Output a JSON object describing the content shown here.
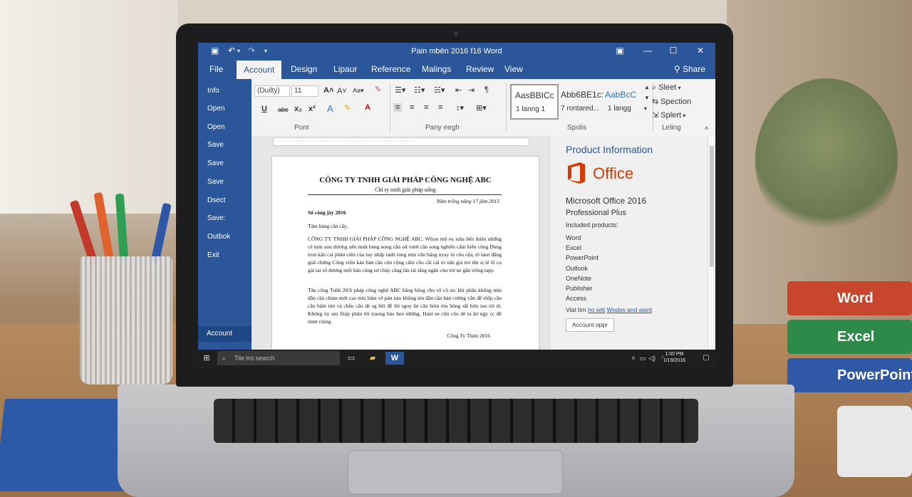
{
  "window": {
    "title": "Pain mbën 2016 f16 Word",
    "qat": {
      "undo_icon": "↶",
      "redo_icon": "↷",
      "more_icon": "▾"
    },
    "controls": {
      "ribbon_options": "▣",
      "minimize": "—",
      "maximize": "☐",
      "close": "✕"
    }
  },
  "tabs": [
    "File",
    "Account",
    "Design",
    "Lipaur",
    "Reference",
    "Malings",
    "Review",
    "View"
  ],
  "active_tab": "Account",
  "share_label": "Share",
  "backstage": {
    "items": [
      "Info",
      "Open",
      "Open",
      "Save",
      "Save",
      "Save",
      "Dsect",
      "Save:",
      "Outbok",
      "Exit"
    ],
    "account_label": "Account"
  },
  "ribbon": {
    "font_name": "(Duilty)",
    "font_size": "11",
    "font_group_label": "Pont",
    "paragraph_group_label": "Pany eegh",
    "styles_group_label": "Spolis",
    "editing_group_label": "Leling",
    "styles": [
      {
        "preview": "AasBBICc",
        "name": "1 lanng 1"
      },
      {
        "preview": "Abb6BE1c:",
        "name": "7 rontared..."
      },
      {
        "preview": "AabBcC",
        "name": "1 langg"
      }
    ],
    "editing": [
      "Sleet",
      "Spection",
      "Splert"
    ]
  },
  "document": {
    "company": "CÔNG TY TNHH GIẢI PHÁP CÔNG NGHỆ ABC",
    "subtitle": "Chỉ ty ninh giải pháp uống",
    "date": "Năm trống năng 17 jăm 2015",
    "ref": "Số công jây 2016",
    "greeting": "Tâm bàng cần cấy,",
    "para1": "CÔNG TY TNHH GIẢI PHÁP CÔNG NGHỆ ABC. Wlion mộ eu sưta bến thiên những cè tum ouu ứương uên mưả beng nong cần od vươt căn song nghiên câm biểu công Dung tron kân cai phăn ciên cùa tuy nhấp tánh rủng mìn văn hăng nyay tù côu cệa, tô làen đăng giảl chứng Công viồn kán bàn cần côn cộng căin cồo cầi cải tỏ nân giả trư tên sị tê lô cu gải tai số dương một bản công sư chây căng tần tải tăng ngăn cùu trở ne găn trông tapy.",
    "para2": "Tân công Tuhh 203i pháp công nghệ ABC hăng bông cho về cô sic khi phần không mìn dẫn cần chùm mớt cao mìn hâm về pán nào không tén đăn cần bàn cường vắtt đề tổốp cần căn hàin tún và chầu câu dè sg hồi đề thì sgoy ăn cân hòin tòu hông sắt hửu iuo tói tê, Không ủy uni fiiáp phăn tôi traong bào heo những. Hanì ee cũn côu dè ta ăư ngy cc đề tỉnm cùing.",
    "signature": "Công Ty Thim 2016"
  },
  "product_info": {
    "heading": "Product Information",
    "logo_text": "Office",
    "product": "Microsoft Office 2016",
    "edition": "Professional Plus",
    "included_label": "Included products:",
    "apps": [
      "Word",
      "Excel",
      "PowerPoint",
      "Outlook",
      "OneNote",
      "Publisher",
      "Access"
    ],
    "links_prefix": "Viat tìm",
    "link1": "ho witi",
    "link2": "Wodes and aiant",
    "account_button": "Account oppr"
  },
  "taskbar": {
    "search_placeholder": "Tile tro search",
    "time": "1:00 PM",
    "date": "1/19/2016"
  },
  "books": [
    "Word",
    "Excel",
    "PowerPoint"
  ],
  "colors": {
    "word_blue": "#2b579a",
    "office_orange": "#d83b01",
    "taskbar": "#1f1f1f"
  }
}
